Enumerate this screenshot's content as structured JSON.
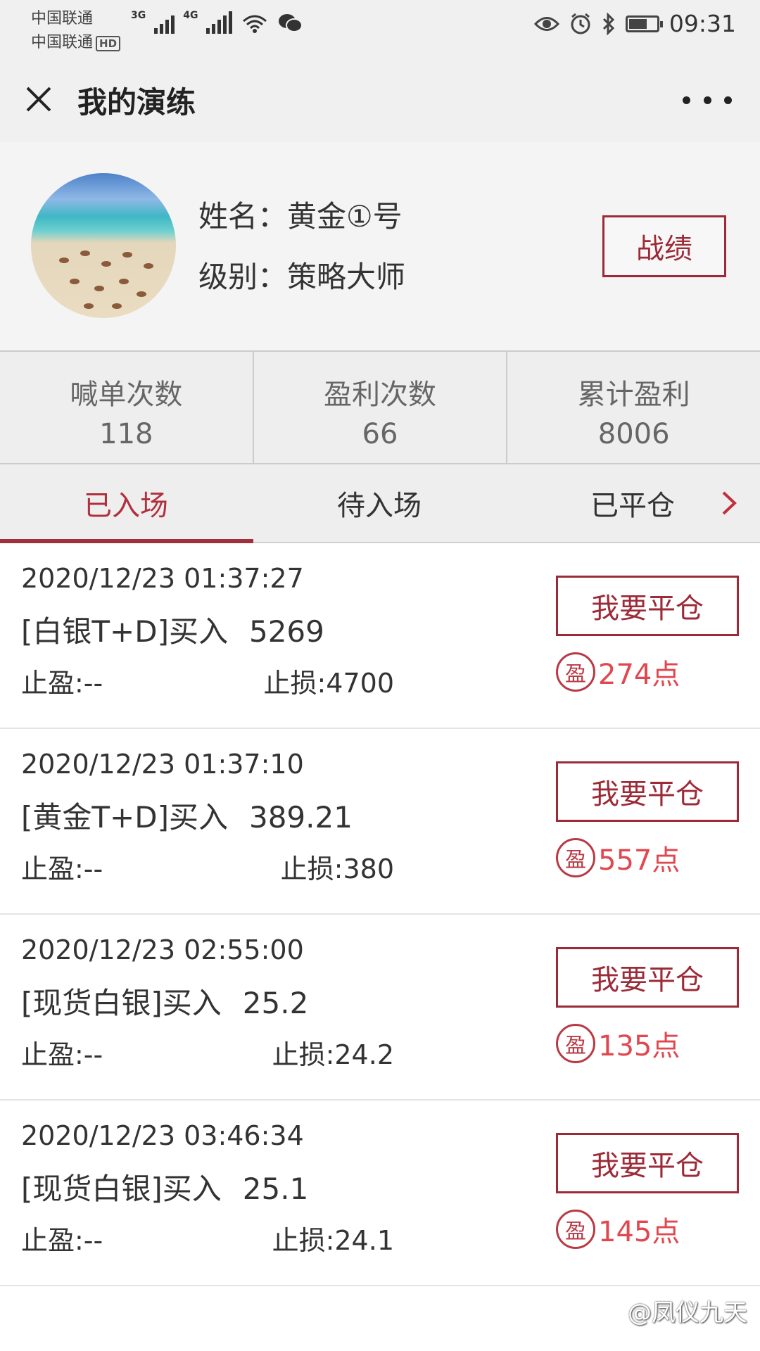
{
  "status_bar": {
    "carrier_1": "中国联通",
    "carrier_2": "中国联通",
    "hd": "HD",
    "net_3g": "3G",
    "net_4g": "4G",
    "time": "09:31"
  },
  "header": {
    "title": "我的演练"
  },
  "profile": {
    "name_line": "姓名：黄金①号",
    "level_line": "级别：策略大师",
    "record_button": "战绩"
  },
  "stats": [
    {
      "label": "喊单次数",
      "value": "118"
    },
    {
      "label": "盈利次数",
      "value": "66"
    },
    {
      "label": "累计盈利",
      "value": "8006"
    }
  ],
  "tabs": {
    "items": [
      "已入场",
      "待入场",
      "已平仓"
    ],
    "active": 0
  },
  "positions": [
    {
      "time": "2020/12/23 01:37:27",
      "instrument": "[白银T+D]买入",
      "price": "5269",
      "take_profit": "止盈:--",
      "stop_loss": "止损:4700",
      "button": "我要平仓",
      "badge": "盈",
      "profit": "274点"
    },
    {
      "time": "2020/12/23 01:37:10",
      "instrument": "[黄金T+D]买入",
      "price": "389.21",
      "take_profit": "止盈:--",
      "stop_loss": "止损:380",
      "button": "我要平仓",
      "badge": "盈",
      "profit": "557点"
    },
    {
      "time": "2020/12/23 02:55:00",
      "instrument": "[现货白银]买入",
      "price": "25.2",
      "take_profit": "止盈:--",
      "stop_loss": "止损:24.2",
      "button": "我要平仓",
      "badge": "盈",
      "profit": "135点"
    },
    {
      "time": "2020/12/23 03:46:34",
      "instrument": "[现货白银]买入",
      "price": "25.1",
      "take_profit": "止盈:--",
      "stop_loss": "止损:24.1",
      "button": "我要平仓",
      "badge": "盈",
      "profit": "145点"
    }
  ],
  "watermark": "@凤仪九天",
  "colors": {
    "accent": "#9c2a37",
    "profit": "#e0484f",
    "header_bg": "#f0f0f0"
  },
  "icons": {
    "close": "close-icon",
    "more": "more-icon",
    "tab_next": "chevron-right-icon"
  }
}
